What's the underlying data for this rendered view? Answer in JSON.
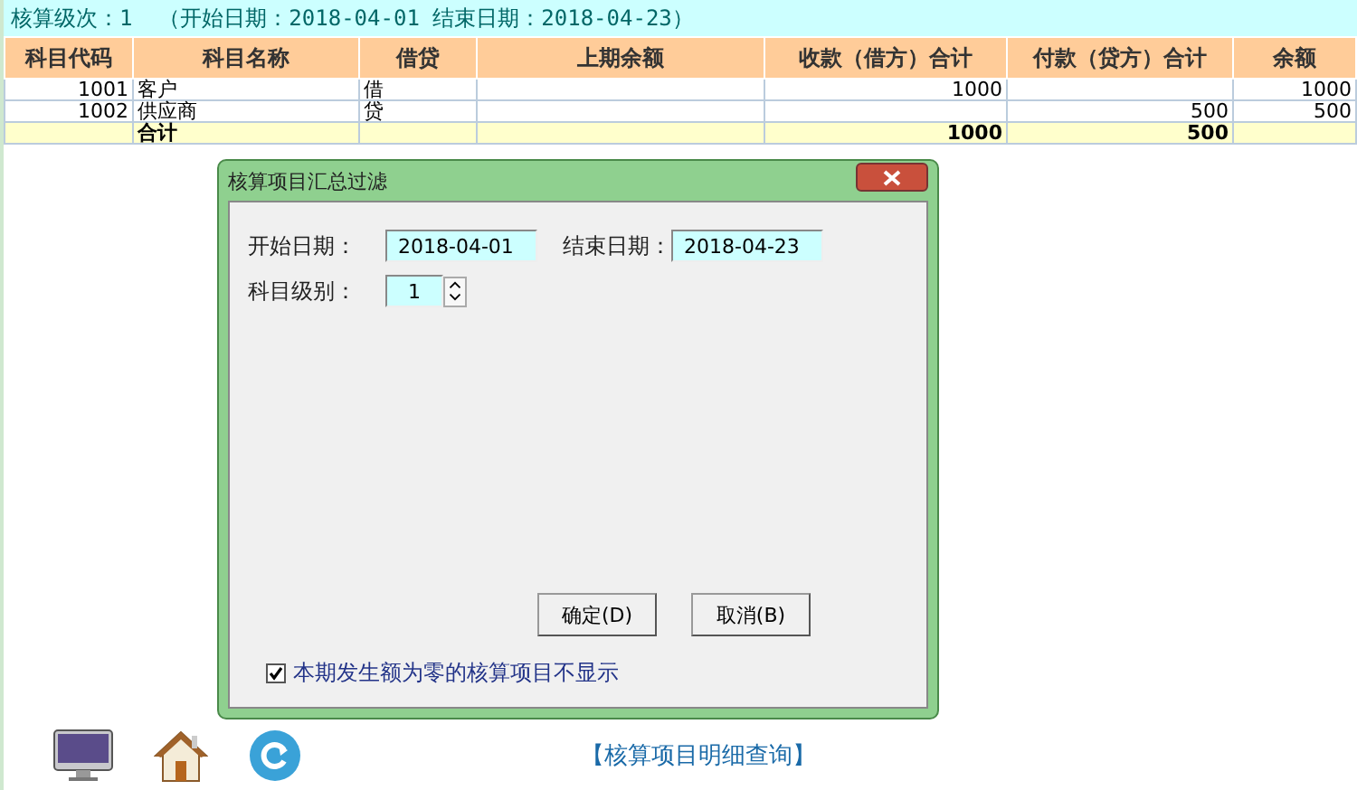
{
  "header": {
    "text": "核算级次：1  （开始日期：2018-04-01 结束日期：2018-04-23）"
  },
  "table": {
    "columns": [
      "科目代码",
      "科目名称",
      "借贷",
      "上期余额",
      "收款（借方）合计",
      "付款（贷方）合计",
      "余额"
    ],
    "rows": [
      {
        "kind": "item",
        "cells": [
          "1001",
          "客户",
          "借",
          "",
          "1000",
          "",
          "1000"
        ]
      },
      {
        "kind": "item",
        "cells": [
          "1002",
          "供应商",
          "贷",
          "",
          "",
          "500",
          "500"
        ]
      },
      {
        "kind": "total",
        "cells": [
          "",
          "合计",
          "",
          "",
          "1000",
          "500",
          ""
        ]
      }
    ]
  },
  "dialog": {
    "title": "核算项目汇总过滤",
    "fields": [
      {
        "label": "开始日期：",
        "value": "2018-04-01",
        "kind": "text"
      },
      {
        "label": "结束日期：",
        "value": "2018-04-23",
        "kind": "text"
      },
      {
        "label": "科目级别：",
        "value": "1",
        "kind": "spinner"
      }
    ],
    "buttons": [
      "确定(D)",
      "取消(B)"
    ],
    "checkbox": {
      "label": "本期发生额为零的核算项目不显示",
      "checked": true
    }
  },
  "toolbar": {
    "icons": [
      {
        "kind": "monitor"
      },
      {
        "kind": "home"
      },
      {
        "kind": "refresh"
      }
    ],
    "link": "【核算项目明细查询】"
  }
}
